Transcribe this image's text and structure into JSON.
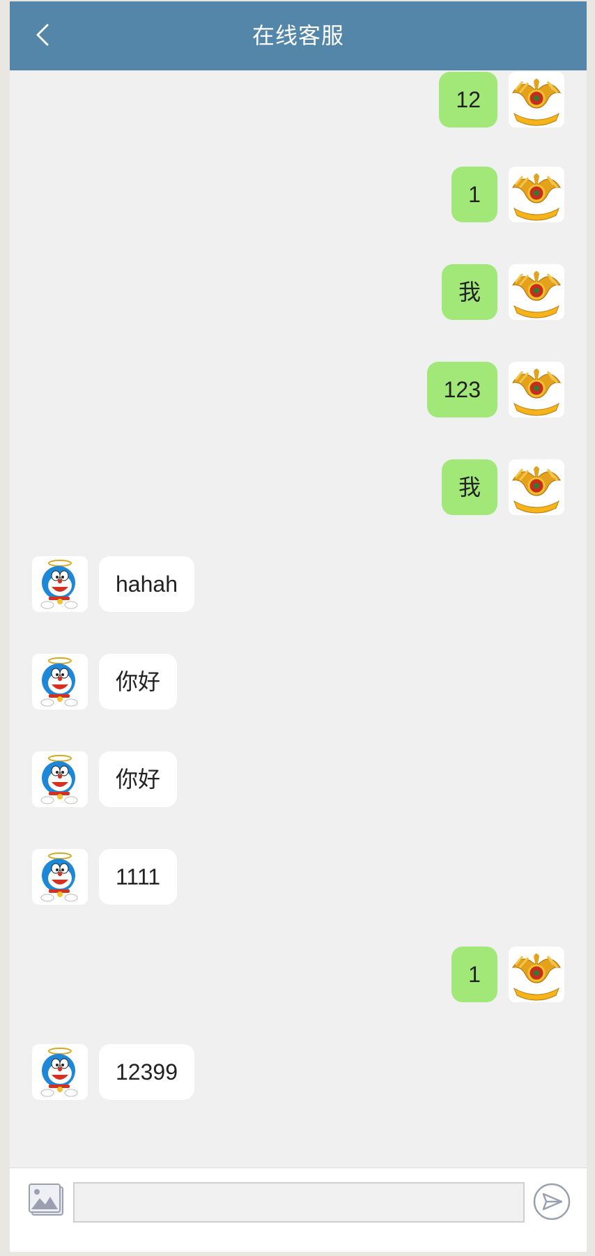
{
  "header": {
    "title": "在线客服",
    "back_icon": "chevron-left-icon"
  },
  "colors": {
    "header_bg": "#5486a9",
    "self_bubble": "#a1e879",
    "other_bubble": "#ffffff",
    "chat_bg": "#f0f0f0"
  },
  "messages": [
    {
      "side": "right",
      "text": "12"
    },
    {
      "side": "right",
      "text": "1"
    },
    {
      "side": "right",
      "text": "我"
    },
    {
      "side": "right",
      "text": "123"
    },
    {
      "side": "right",
      "text": "我"
    },
    {
      "side": "left",
      "text": "hahah"
    },
    {
      "side": "left",
      "text": "你好"
    },
    {
      "side": "left",
      "text": "你好"
    },
    {
      "side": "left",
      "text": "1111"
    },
    {
      "side": "right",
      "text": "1"
    },
    {
      "side": "left",
      "text": "12399"
    }
  ],
  "avatars": {
    "self": "eagle-emblem-avatar",
    "agent": "doraemon-avatar"
  },
  "composer": {
    "image_icon": "image-icon",
    "input_value": "",
    "input_placeholder": "",
    "send_icon": "send-icon"
  }
}
